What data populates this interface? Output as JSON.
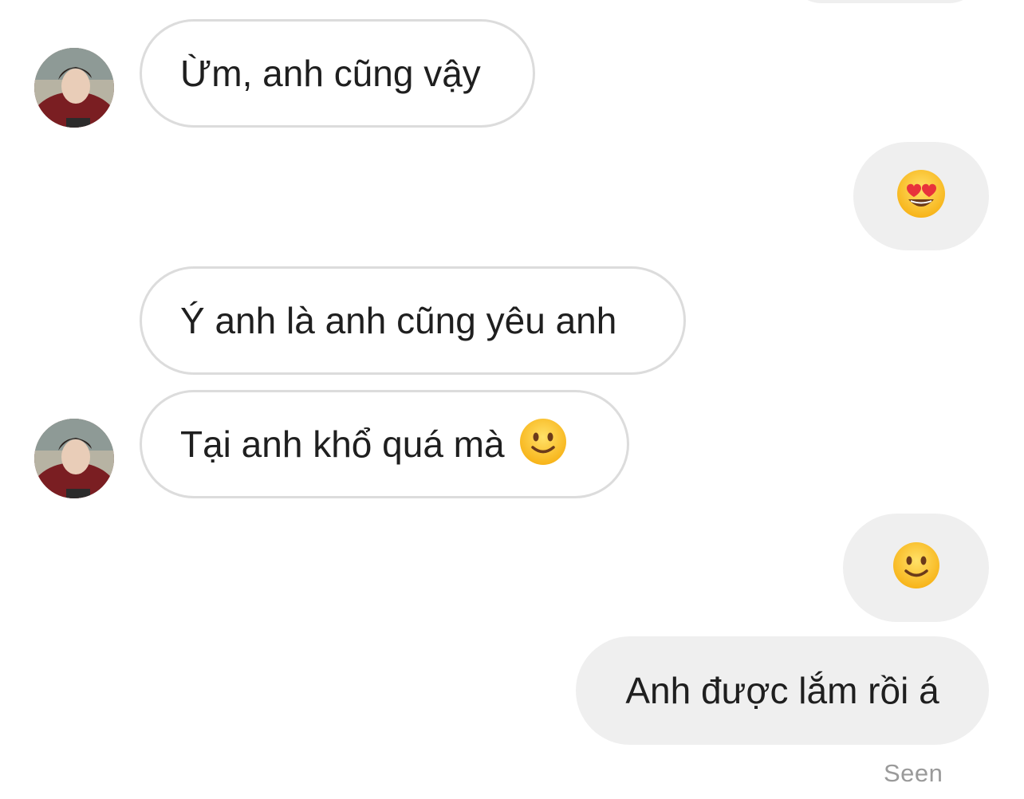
{
  "messages": [
    {
      "side": "incoming",
      "text": "Ừm, anh cũng vậy",
      "avatar": true
    },
    {
      "side": "outgoing",
      "emoji": "heart-eyes-emoji"
    },
    {
      "side": "incoming",
      "text": "Ý anh là anh cũng yêu anh",
      "avatar": false
    },
    {
      "side": "incoming",
      "text": "Tại anh khổ quá mà",
      "emoji": "slightly-smiling-emoji",
      "avatar": true
    },
    {
      "side": "outgoing",
      "emoji": "slightly-smiling-emoji"
    },
    {
      "side": "outgoing",
      "text": "Anh được lắm rồi á"
    }
  ],
  "status": {
    "seen_label": "Seen"
  },
  "colors": {
    "incoming_border": "#dcdcdc",
    "outgoing_bg": "#efefef",
    "text": "#1f1f1f",
    "seen": "#9a9a9a"
  }
}
